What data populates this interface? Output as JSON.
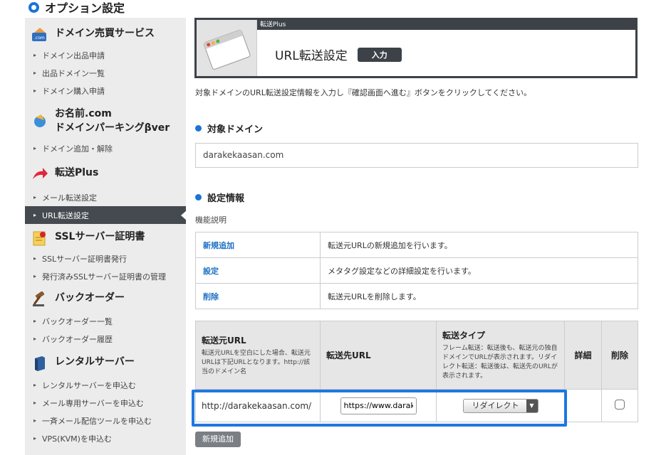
{
  "page": {
    "title": "オプション設定"
  },
  "sidebar": {
    "sections": [
      {
        "title": "ドメイン売買サービス",
        "icon": "domain-com-icon",
        "items": [
          "ドメイン出品申請",
          "出品ドメイン一覧",
          "ドメイン購入申請"
        ]
      },
      {
        "title": "お名前.com",
        "subtitle": "ドメインパーキングβver",
        "icon": "parking-icon",
        "items": [
          "ドメイン追加・解除"
        ]
      },
      {
        "title": "転送Plus",
        "icon": "forward-arrow-icon",
        "items": [
          "メール転送設定",
          "URL転送設定"
        ]
      },
      {
        "title": "SSLサーバー証明書",
        "icon": "certificate-icon",
        "items": [
          "SSLサーバー証明書発行",
          "発行済みSSLサーバー証明書の管理"
        ]
      },
      {
        "title": "バックオーダー",
        "icon": "gavel-icon",
        "items": [
          "バックオーダー一覧",
          "バックオーダー履歴"
        ]
      },
      {
        "title": "レンタルサーバー",
        "icon": "server-icon",
        "items": [
          "レンタルサーバーを申込む",
          "メール専用サーバーを申込む",
          "一斉メール配信ツールを申込む",
          "VPS(KVM)を申込む"
        ]
      }
    ]
  },
  "panel": {
    "tag": "転送Plus",
    "title": "URL転送設定",
    "badge": "入力"
  },
  "intro": "対象ドメインのURL転送設定情報を入力し『確認画面へ進む』ボタンをクリックしてください。",
  "target": {
    "heading": "対象ドメイン",
    "domain": "darakekaasan.com"
  },
  "settings": {
    "heading": "設定情報",
    "func_label": "機能説明",
    "functions": [
      {
        "key": "新規追加",
        "desc": "転送元URLの新規追加を行います。"
      },
      {
        "key": "設定",
        "desc": "メタタグ設定などの詳細設定を行います。"
      },
      {
        "key": "削除",
        "desc": "転送元URLを削除します。"
      }
    ]
  },
  "url_table": {
    "headers": {
      "source": "転送元URL",
      "source_note": "転送元URLを空白にした場合、転送元URLは下記URLとなります。http://該当のドメイン名",
      "dest": "転送先URL",
      "type": "転送タイプ",
      "type_note": "フレーム転送：転送後も、転送元の独自ドメインでURLが表示されます。リダイレクト転送：転送後は、転送先のURLが表示されます。",
      "detail": "詳細",
      "delete": "削除"
    },
    "row": {
      "source": "http://darakekaasan.com/",
      "dest": "https://www.darakekaasan.com/",
      "type": "リダイレクト"
    }
  },
  "add_button": "新規追加",
  "colors": {
    "accent": "#1a73d9",
    "dark": "#3c4248",
    "highlight": "#1f77e0"
  }
}
